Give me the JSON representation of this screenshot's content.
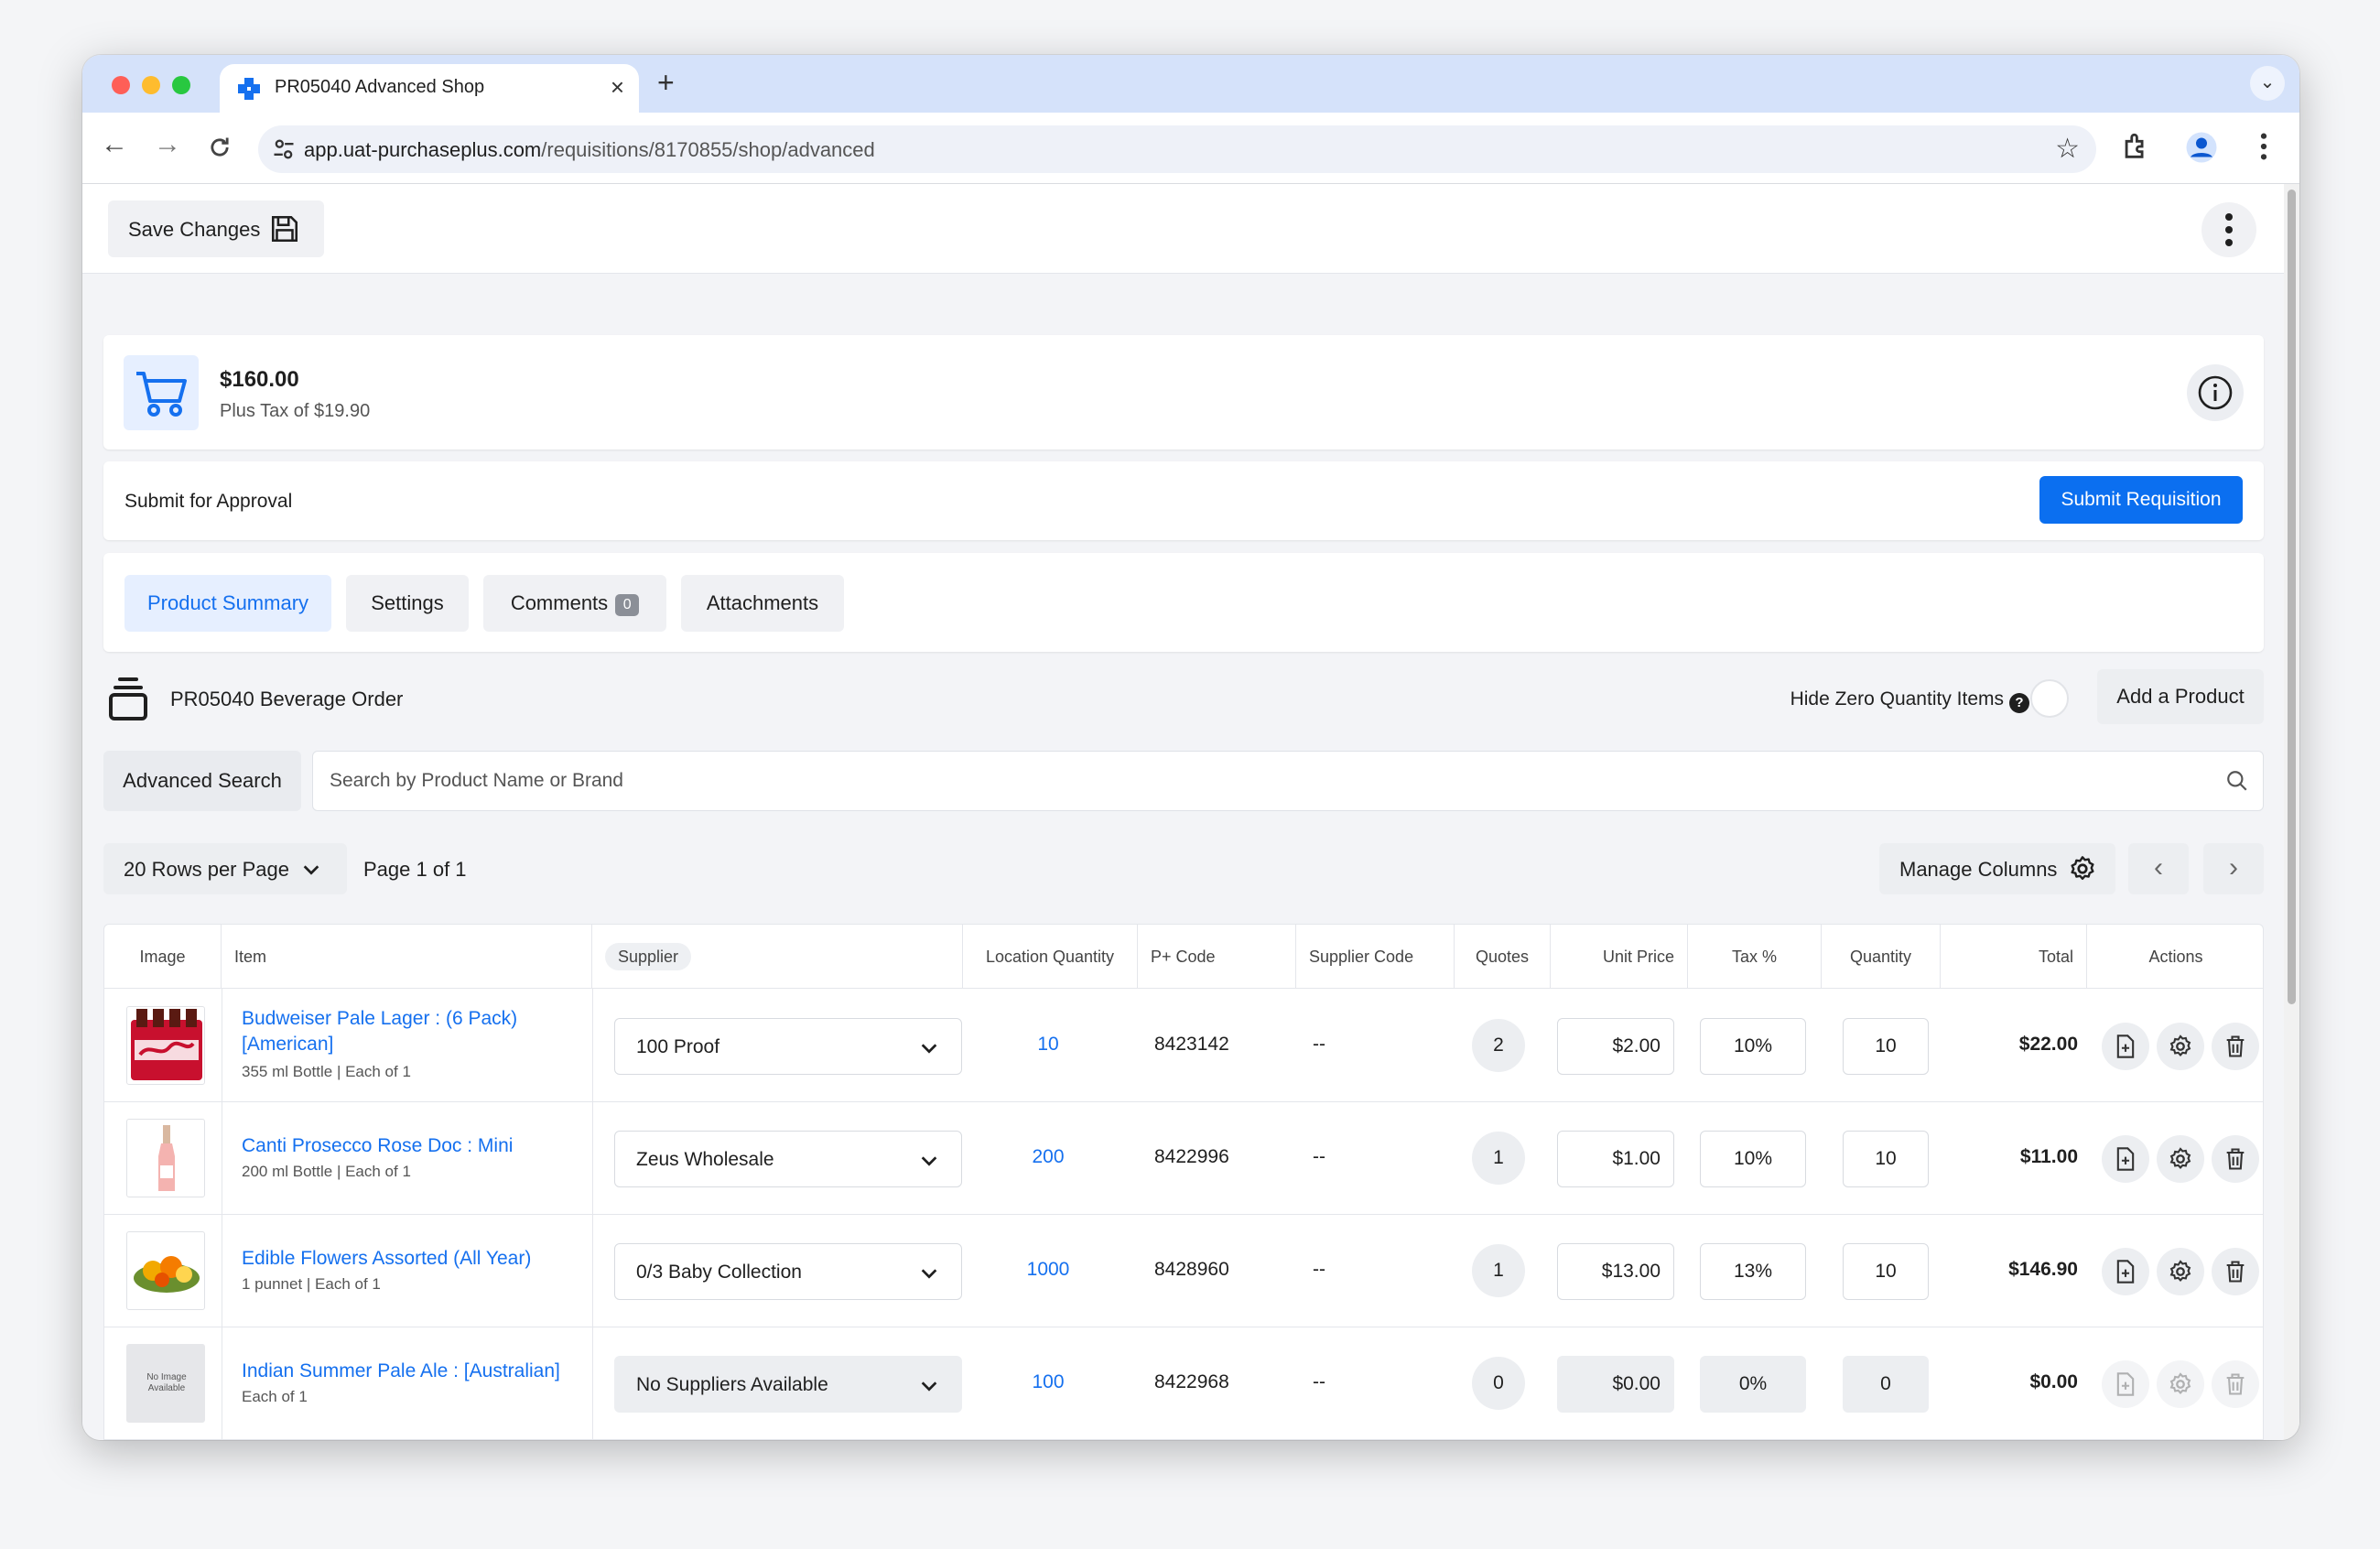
{
  "browser": {
    "tab_title": "PR05040 Advanced Shop",
    "url_host": "app.uat-purchaseplus.com",
    "url_path": "/requisitions/8170855/shop/advanced"
  },
  "topbar": {
    "save_label": "Save Changes"
  },
  "totals": {
    "amount": "$160.00",
    "tax": "Plus Tax of $19.90"
  },
  "approval": {
    "label": "Submit for Approval",
    "submit_label": "Submit Requisition"
  },
  "tabs": [
    {
      "label": "Product Summary"
    },
    {
      "label": "Settings"
    },
    {
      "label": "Comments",
      "count": "0"
    },
    {
      "label": "Attachments"
    }
  ],
  "order": {
    "title": "PR05040 Beverage Order",
    "hide_zero_label": "Hide Zero Quantity Items",
    "help_glyph": "?",
    "add_product_label": "Add a Product"
  },
  "search": {
    "advanced_label": "Advanced Search",
    "placeholder": "Search by Product Name or Brand"
  },
  "pager": {
    "rows_label": "20 Rows per Page",
    "page_label": "Page 1 of 1",
    "manage_columns_label": "Manage Columns"
  },
  "table": {
    "columns": {
      "image": "Image",
      "item": "Item",
      "supplier": "Supplier",
      "location_quantity": "Location Quantity",
      "p_code": "P+ Code",
      "supplier_code": "Supplier Code",
      "quotes": "Quotes",
      "unit_price": "Unit Price",
      "tax": "Tax %",
      "quantity": "Quantity",
      "total": "Total",
      "actions": "Actions"
    },
    "rows": [
      {
        "name_line1": "Budweiser Pale Lager : (6 Pack)",
        "name_line2": "[American]",
        "sub": "355 ml Bottle | Each of 1",
        "supplier": "100 Proof",
        "location_qty": "10",
        "p_code": "8423142",
        "supplier_code": "--",
        "quotes": "2",
        "unit_price": "$2.00",
        "tax": "10%",
        "quantity": "10",
        "total": "$22.00"
      },
      {
        "name_line1": "Canti Prosecco Rose Doc : Mini",
        "sub": "200 ml Bottle | Each of 1",
        "supplier": "Zeus Wholesale",
        "location_qty": "200",
        "p_code": "8422996",
        "supplier_code": "--",
        "quotes": "1",
        "unit_price": "$1.00",
        "tax": "10%",
        "quantity": "10",
        "total": "$11.00"
      },
      {
        "name_line1": "Edible Flowers Assorted (All Year)",
        "sub": "1 punnet | Each of 1",
        "supplier": "0/3 Baby Collection",
        "location_qty": "1000",
        "p_code": "8428960",
        "supplier_code": "--",
        "quotes": "1",
        "unit_price": "$13.00",
        "tax": "13%",
        "quantity": "10",
        "total": "$146.90"
      },
      {
        "name_line1": "Indian Summer Pale Ale : [Australian]",
        "sub": "Each of 1",
        "no_image_text": "No Image Available",
        "supplier": "No Suppliers Available",
        "location_qty": "100",
        "p_code": "8422968",
        "supplier_code": "--",
        "quotes": "0",
        "unit_price": "$0.00",
        "tax": "0%",
        "quantity": "0",
        "total": "$0.00"
      }
    ]
  },
  "colors": {
    "accent": "#0b6ff0",
    "link": "#1570ef",
    "tab_strip": "#d5e2fa"
  }
}
